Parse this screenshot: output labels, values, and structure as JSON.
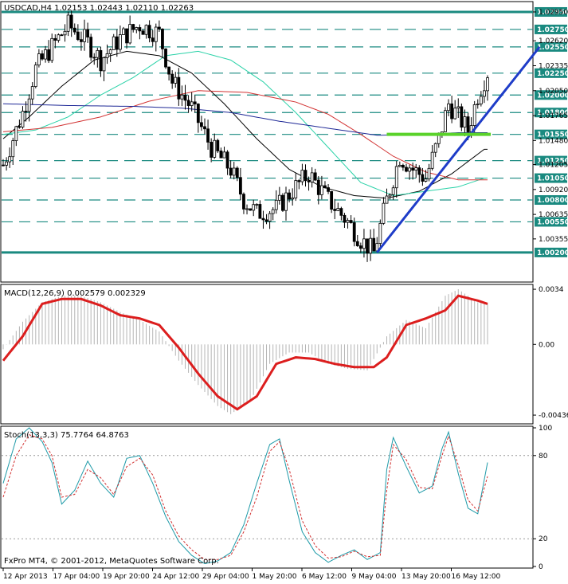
{
  "chart_data": [
    {
      "type": "candlestick",
      "panel": "price",
      "header": "USDCAD,H4  1.02153 1.02443 1.02110 1.02263",
      "symbol": "USDCAD",
      "timeframe": "H4",
      "ohlc_last": {
        "open": 1.02153,
        "high": 1.02443,
        "low": 1.0211,
        "close": 1.02263
      },
      "ylim": [
        0.9988,
        1.0305
      ],
      "price_labels": [
        "1.02950",
        "1.02620",
        "1.02335",
        "1.02050",
        "1.01765",
        "1.01480",
        "1.01205",
        "1.00920",
        "1.00635",
        "1.00355"
      ],
      "levels": [
        {
          "label": "1.02950",
          "value": 1.0295,
          "style": "solid",
          "color": "#1a8a80"
        },
        {
          "label": "1.02750",
          "value": 1.0275,
          "style": "dashed",
          "color": "#1a8a80"
        },
        {
          "label": "1.02550",
          "value": 1.0255,
          "style": "dashed",
          "color": "#1a8a80"
        },
        {
          "label": "1.02250",
          "value": 1.0225,
          "style": "dashed",
          "color": "#1a8a80"
        },
        {
          "label": "1.02000",
          "value": 1.02,
          "style": "dashed",
          "color": "#1a8a80"
        },
        {
          "label": "1.01800",
          "value": 1.018,
          "style": "dashed",
          "color": "#1a8a80"
        },
        {
          "label": "1.01550",
          "value": 1.0155,
          "style": "dashed",
          "color": "#1a8a80"
        },
        {
          "label": "1.01250",
          "value": 1.0125,
          "style": "dashed",
          "color": "#1a8a80"
        },
        {
          "label": "1.01050",
          "value": 1.0105,
          "style": "dashed",
          "color": "#1a8a80"
        },
        {
          "label": "1.00800",
          "value": 1.008,
          "style": "dashed",
          "color": "#1a8a80"
        },
        {
          "label": "1.00550",
          "value": 1.0055,
          "style": "dashed",
          "color": "#1a8a80"
        },
        {
          "label": "1.00200",
          "value": 1.002,
          "style": "solid",
          "color": "#1a8a80"
        }
      ],
      "trendline": {
        "from": [
          115,
          1.002
        ],
        "to": [
          165,
          1.0255
        ],
        "color": "#1e3cc8"
      },
      "horizontal_marker": {
        "from": 118,
        "to": 150,
        "value": 1.0155,
        "color": "#5ad22a"
      },
      "moving_averages": [
        {
          "color": "#000000",
          "points": [
            [
              0,
              1.015
            ],
            [
              8,
              1.0175
            ],
            [
              18,
              1.021
            ],
            [
              28,
              1.024
            ],
            [
              38,
              1.025
            ],
            [
              48,
              1.0245
            ],
            [
              58,
              1.0225
            ],
            [
              68,
              1.019
            ],
            [
              78,
              1.015
            ],
            [
              88,
              1.0115
            ],
            [
              98,
              1.0095
            ],
            [
              108,
              1.0085
            ],
            [
              118,
              1.0082
            ],
            [
              128,
              1.009
            ],
            [
              138,
              1.011
            ],
            [
              148,
              1.0138
            ]
          ]
        },
        {
          "color": "#2ad2a8",
          "points": [
            [
              0,
              1.0155
            ],
            [
              10,
              1.016
            ],
            [
              20,
              1.0175
            ],
            [
              30,
              1.02
            ],
            [
              40,
              1.022
            ],
            [
              50,
              1.0245
            ],
            [
              60,
              1.025
            ],
            [
              70,
              1.024
            ],
            [
              80,
              1.0215
            ],
            [
              90,
              1.018
            ],
            [
              100,
              1.014
            ],
            [
              110,
              1.01
            ],
            [
              120,
              1.0085
            ],
            [
              130,
              1.009
            ],
            [
              140,
              1.0095
            ],
            [
              148,
              1.0105
            ]
          ]
        },
        {
          "color": "#d23232",
          "points": [
            [
              0,
              1.0158
            ],
            [
              15,
              1.0163
            ],
            [
              30,
              1.0175
            ],
            [
              45,
              1.0193
            ],
            [
              60,
              1.0205
            ],
            [
              75,
              1.0203
            ],
            [
              90,
              1.0192
            ],
            [
              100,
              1.0178
            ],
            [
              110,
              1.0155
            ],
            [
              120,
              1.013
            ],
            [
              130,
              1.0112
            ],
            [
              140,
              1.0103
            ],
            [
              148,
              1.0103
            ]
          ]
        },
        {
          "color": "#1e2896",
          "points": [
            [
              0,
              1.019
            ],
            [
              20,
              1.0188
            ],
            [
              40,
              1.0187
            ],
            [
              55,
              1.0185
            ],
            [
              70,
              1.018
            ],
            [
              85,
              1.017
            ],
            [
              100,
              1.0162
            ],
            [
              115,
              1.0154
            ],
            [
              130,
              1.0155
            ],
            [
              140,
              1.0157
            ],
            [
              148,
              1.0157
            ]
          ]
        }
      ],
      "price_path": [
        [
          0,
          1.012
        ],
        [
          6,
          1.018
        ],
        [
          10,
          1.023
        ],
        [
          16,
          1.026
        ],
        [
          20,
          1.028
        ],
        [
          26,
          1.026
        ],
        [
          30,
          1.024
        ],
        [
          36,
          1.0265
        ],
        [
          42,
          1.028
        ],
        [
          48,
          1.027
        ],
        [
          52,
          1.0215
        ],
        [
          58,
          1.0185
        ],
        [
          64,
          1.014
        ],
        [
          70,
          1.0115
        ],
        [
          74,
          1.008
        ],
        [
          78,
          1.0065
        ],
        [
          84,
          1.007
        ],
        [
          90,
          1.0095
        ],
        [
          94,
          1.011
        ],
        [
          100,
          1.008
        ],
        [
          106,
          1.0055
        ],
        [
          110,
          1.0035
        ],
        [
          114,
          1.002
        ],
        [
          118,
          1.008
        ],
        [
          122,
          1.013
        ],
        [
          126,
          1.0115
        ],
        [
          130,
          1.0105
        ],
        [
          134,
          1.015
        ],
        [
          137,
          1.019
        ],
        [
          140,
          1.0175
        ],
        [
          143,
          1.016
        ],
        [
          146,
          1.02
        ],
        [
          149,
          1.0226
        ]
      ]
    },
    {
      "type": "line",
      "panel": "macd",
      "header": "MACD(12,26,9) 0.002579 0.002329",
      "params": "12,26,9",
      "values": {
        "macd": 0.002579,
        "signal": 0.002329
      },
      "ylim": [
        -0.0048,
        0.0036
      ],
      "y_labels": [
        "0.0034",
        "0.00",
        "-0.00436"
      ],
      "histogram_color": "#b4b4b4",
      "signal_color": "#dc1e1e",
      "histogram_path": [
        [
          0,
          -0.0003
        ],
        [
          6,
          0.0014
        ],
        [
          12,
          0.0026
        ],
        [
          18,
          0.003
        ],
        [
          24,
          0.003
        ],
        [
          30,
          0.0026
        ],
        [
          36,
          0.002
        ],
        [
          42,
          0.0015
        ],
        [
          48,
          0.0008
        ],
        [
          54,
          -0.001
        ],
        [
          60,
          -0.0025
        ],
        [
          66,
          -0.0038
        ],
        [
          70,
          -0.0043
        ],
        [
          76,
          -0.0035
        ],
        [
          82,
          -0.0012
        ],
        [
          88,
          -0.0005
        ],
        [
          94,
          -0.0005
        ],
        [
          100,
          -0.0012
        ],
        [
          106,
          -0.0015
        ],
        [
          112,
          -0.0016
        ],
        [
          118,
          0.0005
        ],
        [
          124,
          0.0015
        ],
        [
          130,
          0.001
        ],
        [
          136,
          0.003
        ],
        [
          140,
          0.0034
        ],
        [
          146,
          0.0026
        ],
        [
          149,
          0.0025
        ]
      ],
      "signal_path": [
        [
          0,
          -0.001
        ],
        [
          6,
          0.0005
        ],
        [
          12,
          0.0025
        ],
        [
          18,
          0.0028
        ],
        [
          24,
          0.0028
        ],
        [
          30,
          0.0024
        ],
        [
          36,
          0.0018
        ],
        [
          42,
          0.0016
        ],
        [
          48,
          0.0012
        ],
        [
          54,
          -0.0002
        ],
        [
          60,
          -0.0018
        ],
        [
          66,
          -0.0032
        ],
        [
          72,
          -0.004
        ],
        [
          78,
          -0.0032
        ],
        [
          84,
          -0.0012
        ],
        [
          90,
          -0.0008
        ],
        [
          96,
          -0.0009
        ],
        [
          102,
          -0.0012
        ],
        [
          108,
          -0.0014
        ],
        [
          114,
          -0.0014
        ],
        [
          118,
          -0.0008
        ],
        [
          124,
          0.0012
        ],
        [
          130,
          0.0016
        ],
        [
          136,
          0.0021
        ],
        [
          140,
          0.003
        ],
        [
          146,
          0.0027
        ],
        [
          149,
          0.0025
        ]
      ]
    },
    {
      "type": "line",
      "panel": "stochastic",
      "header": "Stoch(13,3,3) 75.7764 64.8763",
      "params": "13,3,3",
      "values": {
        "main": 75.7764,
        "signal": 64.8763
      },
      "ylim": [
        0,
        100
      ],
      "y_labels": [
        "100",
        "80",
        "20",
        "0"
      ],
      "main_color": "#1e9aa8",
      "signal_color": "#d23232",
      "main_path": [
        [
          0,
          60
        ],
        [
          4,
          92
        ],
        [
          8,
          100
        ],
        [
          12,
          90
        ],
        [
          15,
          75
        ],
        [
          18,
          45
        ],
        [
          22,
          55
        ],
        [
          26,
          76
        ],
        [
          30,
          60
        ],
        [
          34,
          50
        ],
        [
          38,
          78
        ],
        [
          42,
          80
        ],
        [
          46,
          60
        ],
        [
          50,
          36
        ],
        [
          54,
          18
        ],
        [
          58,
          8
        ],
        [
          62,
          2
        ],
        [
          66,
          4
        ],
        [
          70,
          10
        ],
        [
          74,
          30
        ],
        [
          78,
          60
        ],
        [
          82,
          88
        ],
        [
          85,
          92
        ],
        [
          88,
          62
        ],
        [
          92,
          25
        ],
        [
          96,
          10
        ],
        [
          100,
          3
        ],
        [
          104,
          8
        ],
        [
          108,
          12
        ],
        [
          112,
          5
        ],
        [
          116,
          10
        ],
        [
          118,
          70
        ],
        [
          120,
          93
        ],
        [
          124,
          72
        ],
        [
          128,
          53
        ],
        [
          132,
          58
        ],
        [
          135,
          85
        ],
        [
          137,
          97
        ],
        [
          140,
          67
        ],
        [
          143,
          42
        ],
        [
          146,
          38
        ],
        [
          149,
          75
        ]
      ],
      "signal_path": [
        [
          0,
          50
        ],
        [
          4,
          80
        ],
        [
          8,
          95
        ],
        [
          12,
          92
        ],
        [
          15,
          80
        ],
        [
          18,
          50
        ],
        [
          22,
          52
        ],
        [
          26,
          70
        ],
        [
          30,
          64
        ],
        [
          34,
          52
        ],
        [
          38,
          72
        ],
        [
          42,
          78
        ],
        [
          46,
          66
        ],
        [
          50,
          40
        ],
        [
          54,
          22
        ],
        [
          58,
          12
        ],
        [
          62,
          5
        ],
        [
          66,
          5
        ],
        [
          70,
          8
        ],
        [
          74,
          25
        ],
        [
          78,
          50
        ],
        [
          82,
          83
        ],
        [
          85,
          90
        ],
        [
          88,
          70
        ],
        [
          92,
          33
        ],
        [
          96,
          15
        ],
        [
          100,
          6
        ],
        [
          104,
          7
        ],
        [
          108,
          11
        ],
        [
          112,
          7
        ],
        [
          116,
          8
        ],
        [
          118,
          55
        ],
        [
          120,
          88
        ],
        [
          124,
          77
        ],
        [
          128,
          57
        ],
        [
          132,
          56
        ],
        [
          135,
          80
        ],
        [
          137,
          94
        ],
        [
          140,
          73
        ],
        [
          143,
          48
        ],
        [
          146,
          40
        ],
        [
          149,
          65
        ]
      ]
    }
  ],
  "x_axis": {
    "labels": [
      "12 Apr 2013",
      "17 Apr 04:00",
      "19 Apr 20:00",
      "24 Apr 12:00",
      "29 Apr 04:00",
      "1 May 20:00",
      "6 May 12:00",
      "9 May 04:00",
      "13 May 20:00",
      "16 May 12:00"
    ]
  },
  "watermark": "FxPro MT4, © 2001-2012, MetaQuotes Software Corp."
}
